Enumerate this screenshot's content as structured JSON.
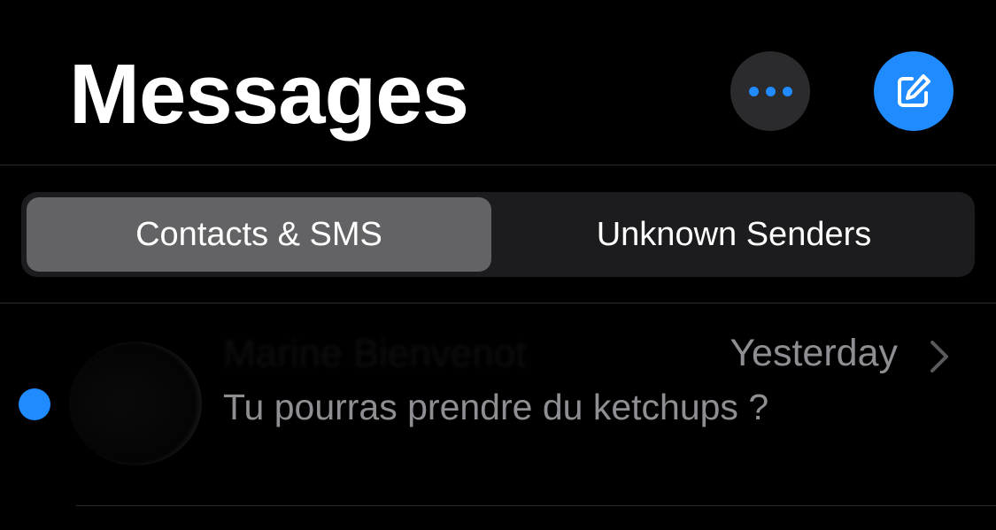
{
  "header": {
    "title": "Messages"
  },
  "filters": {
    "tabs": [
      {
        "label": "Contacts & SMS",
        "active": true
      },
      {
        "label": "Unknown Senders",
        "active": false
      }
    ]
  },
  "conversations": [
    {
      "sender": "Marine Bienvenot",
      "time": "Yesterday",
      "preview": "Tu pourras prendre du ketchups ?",
      "unread": true
    }
  ],
  "colors": {
    "accent": "#1f8bff",
    "background": "#000000",
    "segment_bg": "#1c1c1e",
    "segment_active": "#636366",
    "secondary_text": "#8e8e93"
  },
  "icons": {
    "more": "ellipsis-icon",
    "compose": "compose-icon",
    "chevron": "chevron-right-icon"
  }
}
